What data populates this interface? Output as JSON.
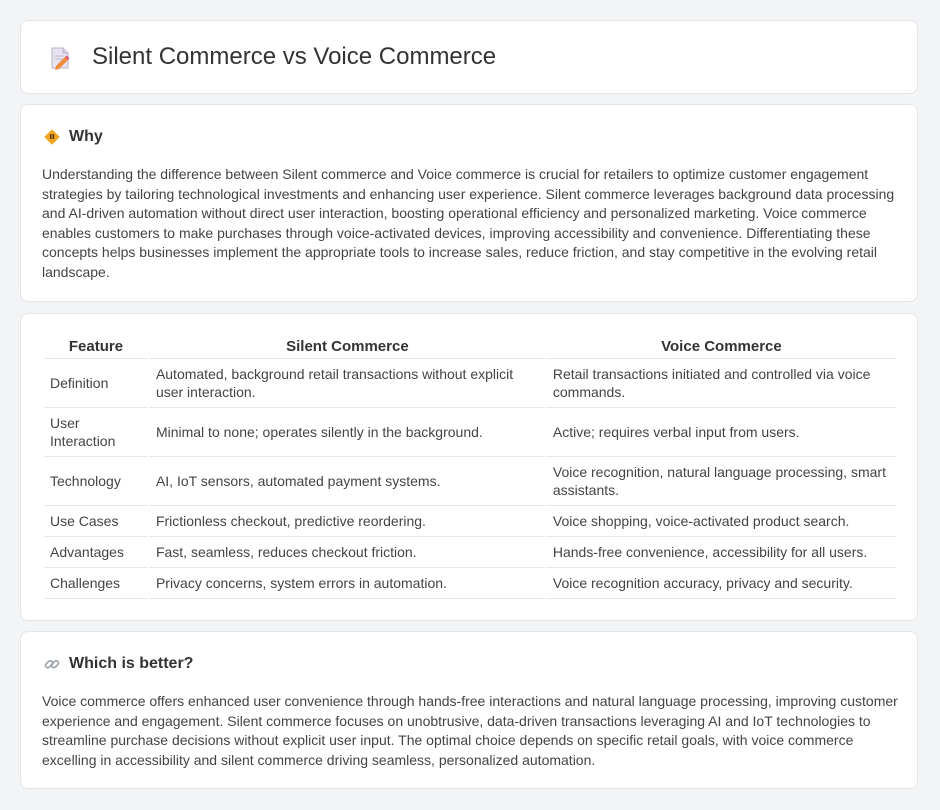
{
  "page": {
    "title": "Silent Commerce vs Voice Commerce",
    "icon": "document-pencil-icon"
  },
  "why": {
    "icon": "diamond-warning-icon",
    "heading": "Why",
    "text": "Understanding the difference between Silent commerce and Voice commerce is crucial for retailers to optimize customer engagement strategies by tailoring technological investments and enhancing user experience. Silent commerce leverages background data processing and AI-driven automation without direct user interaction, boosting operational efficiency and personalized marketing. Voice commerce enables customers to make purchases through voice-activated devices, improving accessibility and convenience. Differentiating these concepts helps businesses implement the appropriate tools to increase sales, reduce friction, and stay competitive in the evolving retail landscape."
  },
  "table": {
    "headers": [
      "Feature",
      "Silent Commerce",
      "Voice Commerce"
    ],
    "rows": [
      [
        "Definition",
        "Automated, background retail transactions without explicit user interaction.",
        "Retail transactions initiated and controlled via voice commands."
      ],
      [
        "User Interaction",
        "Minimal to none; operates silently in the background.",
        "Active; requires verbal input from users."
      ],
      [
        "Technology",
        "AI, IoT sensors, automated payment systems.",
        "Voice recognition, natural language processing, smart assistants."
      ],
      [
        "Use Cases",
        "Frictionless checkout, predictive reordering.",
        "Voice shopping, voice-activated product search."
      ],
      [
        "Advantages",
        "Fast, seamless, reduces checkout friction.",
        "Hands-free convenience, accessibility for all users."
      ],
      [
        "Challenges",
        "Privacy concerns, system errors in automation.",
        "Voice recognition accuracy, privacy and security."
      ]
    ]
  },
  "better": {
    "icon": "link-icon",
    "heading": "Which is better?",
    "text": "Voice commerce offers enhanced user convenience through hands-free interactions and natural language processing, improving customer experience and engagement. Silent commerce focuses on unobtrusive, data-driven transactions leveraging AI and IoT technologies to streamline purchase decisions without explicit user input. The optimal choice depends on specific retail goals, with voice commerce excelling in accessibility and silent commerce driving seamless, personalized automation."
  }
}
